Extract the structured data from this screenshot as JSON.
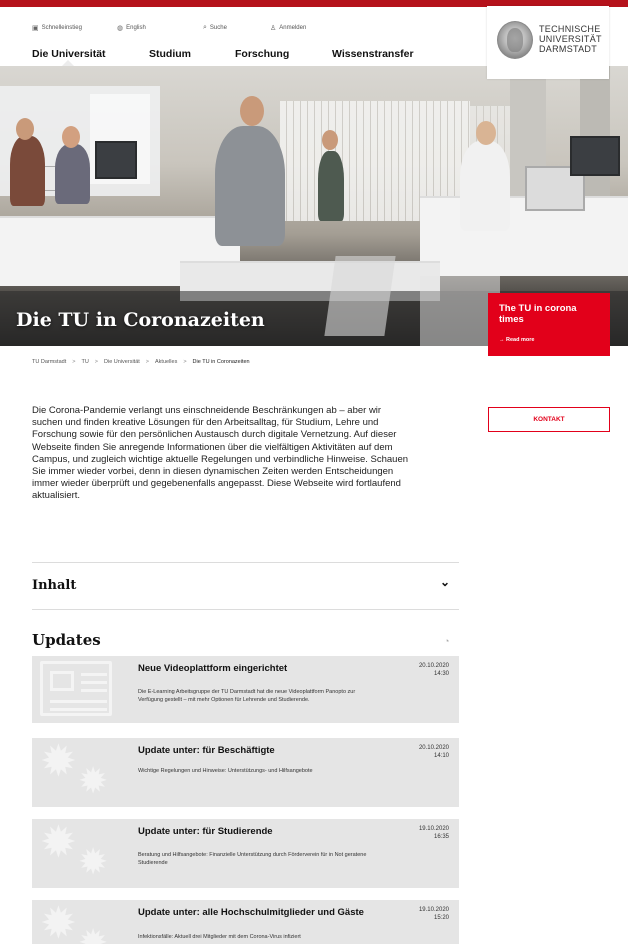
{
  "header": {
    "utility": [
      {
        "icon": "quick-access-icon",
        "glyph": "▣",
        "label": "Schnelleinstieg"
      },
      {
        "icon": "globe-icon",
        "glyph": "◍",
        "label": "English"
      },
      {
        "icon": "search-icon",
        "glyph": "⌕",
        "label": "Suche"
      },
      {
        "icon": "user-icon",
        "glyph": "♙",
        "label": "Anmelden"
      }
    ],
    "nav": [
      "Die Universität",
      "Studium",
      "Forschung",
      "Wissenstransfer"
    ],
    "logo_text": [
      "TECHNISCHE",
      "UNIVERSITÄT",
      "DARMSTADT"
    ]
  },
  "hero": {
    "title": "Die TU in Coronazeiten"
  },
  "teaser": {
    "title": "The TU in corona times",
    "link": "→ Read more"
  },
  "breadcrumb": [
    "TU Darmstadt",
    "TU",
    "Die Universität",
    "Aktuelles",
    "Die TU in Coronazeiten"
  ],
  "breadcrumb_separator": ">",
  "intro": "Die Corona-Pandemie verlangt uns einschneidende Beschränkungen ab – aber wir suchen und finden kreative Lösungen für den Arbeitsalltag, für Studium, Lehre und Forschung sowie für den persönlichen Austausch durch digitale Vernetzung. Auf dieser Webseite finden Sie anregende Informationen über die vielfältigen Aktivitäten auf dem Campus, und zugleich wichtige aktuelle Regelungen und verbindliche Hinweise. Schauen Sie immer wieder vorbei, denn in diesen dynamischen Zeiten werden Entscheidungen immer wieder überprüft und gegebenenfalls angepasst. Diese Webseite wird fortlaufend aktualisiert.",
  "kontakt_label": "KONTAKT",
  "inhalt": {
    "title": "Inhalt",
    "chevron": "⌄"
  },
  "updates": {
    "title": "Updates",
    "rss_icon": "rss-icon",
    "rss_glyph": "◔",
    "items": [
      {
        "title": "Neue Videoplattform eingerichtet",
        "date": "20.10.2020",
        "time": "14:30",
        "desc": "Die E-Learning Arbeitsgruppe der TU Darmstadt hat die neue Videoplattform Panopto zur Verfügung gestellt – mit mehr Optionen für Lehrende und Studierende.",
        "thumb": "newspaper-icon"
      },
      {
        "title": "Update unter: für Beschäftigte",
        "date": "20.10.2020",
        "time": "14:10",
        "desc": "Wichtige Regelungen und Hinweise: Unterstützungs- und Hilfsangebote",
        "thumb": "gears-icon"
      },
      {
        "title": "Update unter: für Studierende",
        "date": "19.10.2020",
        "time": "16:35",
        "desc": "Beratung und Hilfsangebote: Finanzielle Unterstützung durch Förderverein für in Not geratene Studierende",
        "thumb": "gears-icon"
      },
      {
        "title": "Update unter: alle Hochschulmitglieder und Gäste",
        "date": "19.10.2020",
        "time": "15:20",
        "desc": "Infektionsfälle: Aktuell drei Mitglieder mit dem Corona-Virus infiziert",
        "thumb": "gears-icon"
      }
    ]
  },
  "colors": {
    "brand_red": "#e2001a",
    "top_bar": "#b5121b",
    "card_bg": "#e5e5e5"
  }
}
